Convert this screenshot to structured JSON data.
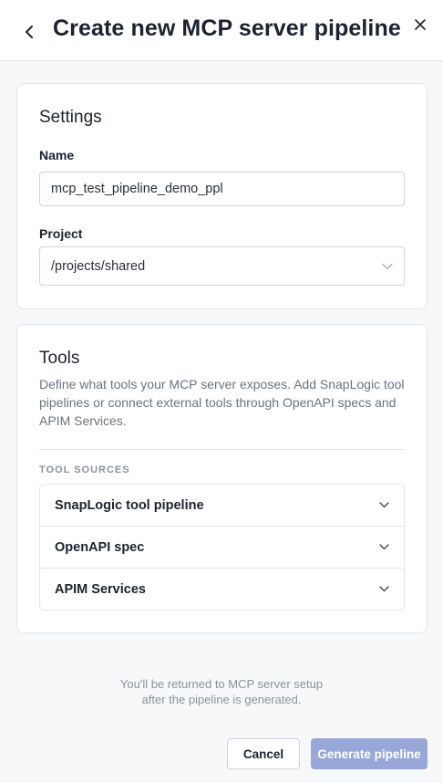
{
  "header": {
    "title": "Create new MCP server pipeline"
  },
  "settings": {
    "title": "Settings",
    "name_label": "Name",
    "name_value": "mcp_test_pipeline_demo_ppl",
    "project_label": "Project",
    "project_value": "/projects/shared"
  },
  "tools": {
    "title": "Tools",
    "description": "Define what tools your MCP server exposes. Add SnapLogic tool pipelines or connect external tools through OpenAPI specs and APIM Services.",
    "sources_label": "TOOL SOURCES",
    "sources": [
      {
        "label": "SnapLogic tool pipeline"
      },
      {
        "label": "OpenAPI spec"
      },
      {
        "label": "APIM Services"
      }
    ]
  },
  "footer": {
    "note_line1": "You'll be returned to MCP server setup",
    "note_line2": "after the pipeline is generated.",
    "cancel_label": "Cancel",
    "generate_label": "Generate pipeline"
  },
  "colors": {
    "primary_disabled": "#97a8d8",
    "border": "#e3e6ea",
    "muted_text": "#8a929c"
  },
  "icons": {
    "back": "chevron-left-icon",
    "close": "close-icon",
    "dropdown": "chevron-down-icon"
  }
}
